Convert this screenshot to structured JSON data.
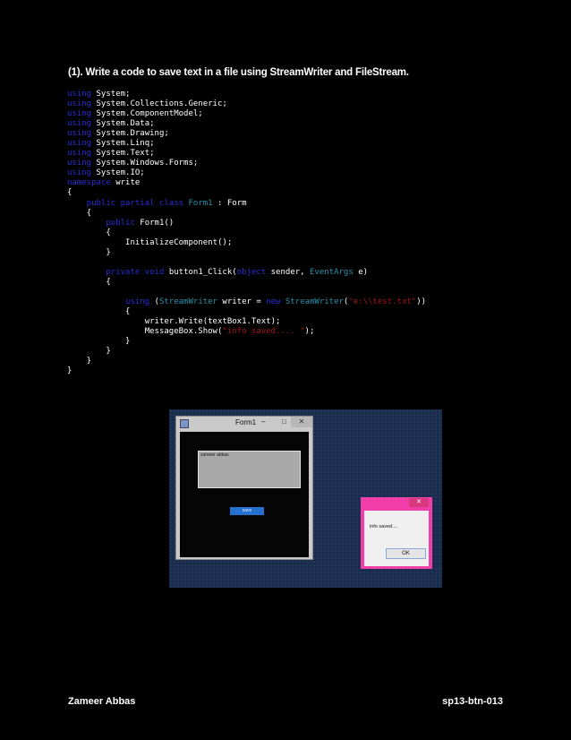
{
  "heading": "(1). Write a code to save text in a file using StreamWriter and FileStream.",
  "code": {
    "using_kw": "using",
    "ns_kw": "namespace",
    "usings": [
      "System;",
      "System.Collections.Generic;",
      "System.ComponentModel;",
      "System.Data;",
      "System.Drawing;",
      "System.Linq;",
      "System.Text;",
      "System.Windows.Forms;",
      "System.IO;"
    ],
    "namespace_name": "write",
    "kw_public": "public",
    "kw_partial": "partial",
    "kw_class": "class",
    "kw_private": "private",
    "kw_void": "void",
    "kw_object": "object",
    "kw_new": "new",
    "class_name": "Form1",
    "base_class": "Form",
    "ctor_call": "Form1()",
    "init_call": "InitializeComponent();",
    "method_name": "button1_Click(",
    "param_sender": "sender,",
    "type_eventargs": "EventArgs",
    "param_e": "e)",
    "type_streamwriter": "StreamWriter",
    "writer_decl": "writer =",
    "path_literal": "\"e:\\\\test.txt\"",
    "write_call": "writer.Write(textBox1.Text);",
    "msgbox_call": "MessageBox.Show(",
    "msg_literal": "\"info saved.... \"",
    "close_paren_semicolon": ");"
  },
  "screenshot": {
    "form_title": "Form1",
    "min_glyph": "–",
    "max_glyph": "□",
    "close_glyph": "✕",
    "textbox_value": "zameer abbas",
    "save_label": "save",
    "msgbox_text": "info saved....",
    "ok_label": "OK"
  },
  "footer": {
    "author": "Zameer Abbas",
    "id": "sp13-btn-013"
  }
}
